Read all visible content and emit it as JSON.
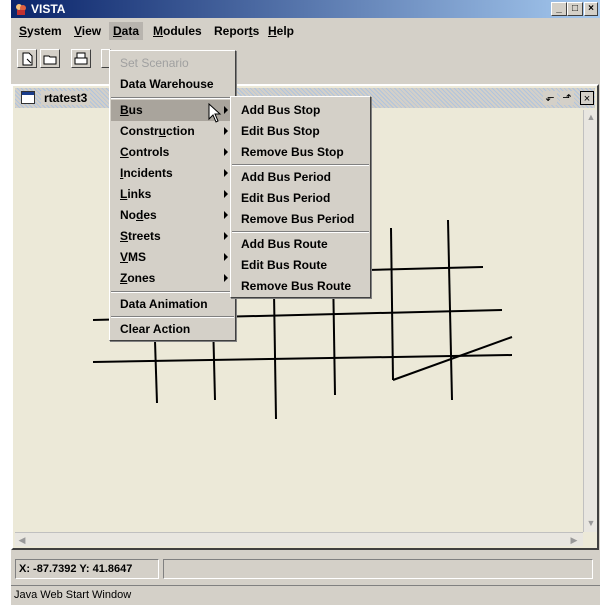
{
  "window": {
    "title": "VISTA"
  },
  "menubar": [
    {
      "label": "System",
      "ul": "S",
      "rest": "ystem"
    },
    {
      "label": "View",
      "ul": "V",
      "rest": "iew"
    },
    {
      "label": "Data",
      "ul": "D",
      "rest": "ata"
    },
    {
      "label": "Modules",
      "ul": "M",
      "rest": "odules"
    },
    {
      "label": "Reports",
      "pre": "Repor",
      "ul": "t",
      "rest": "s"
    },
    {
      "label": "Help",
      "ul": "H",
      "rest": "elp"
    }
  ],
  "internal_frame": {
    "title": "rtatest3"
  },
  "data_menu": {
    "items": [
      {
        "label": "Set Scenario",
        "disabled": true
      },
      {
        "label": "Data Warehouse"
      },
      {
        "label": "Bus",
        "ul": "B",
        "rest": "us",
        "submenu": true,
        "selected": true
      },
      {
        "label": "Construction",
        "pre": "Constr",
        "ul": "u",
        "rest": "ction",
        "submenu": true
      },
      {
        "label": "Controls",
        "ul": "C",
        "rest": "ontrols",
        "submenu": true
      },
      {
        "label": "Incidents",
        "ul": "I",
        "rest": "ncidents",
        "submenu": true
      },
      {
        "label": "Links",
        "ul": "L",
        "rest": "inks",
        "submenu": true
      },
      {
        "label": "Nodes",
        "pre": "No",
        "ul": "d",
        "rest": "es",
        "submenu": true
      },
      {
        "label": "Streets",
        "ul": "S",
        "rest": "treets",
        "submenu": true
      },
      {
        "label": "VMS",
        "ul": "V",
        "rest": "MS",
        "submenu": true
      },
      {
        "label": "Zones",
        "ul": "Z",
        "rest": "ones",
        "submenu": true
      },
      {
        "label": "Data Animation"
      },
      {
        "label": "Clear Action"
      }
    ]
  },
  "bus_submenu": {
    "groups": [
      [
        "Add Bus Stop",
        "Edit Bus Stop",
        "Remove Bus Stop"
      ],
      [
        "Add Bus Period",
        "Edit Bus Period",
        "Remove Bus Period"
      ],
      [
        "Add Bus Route",
        "Edit Bus Route",
        "Remove Bus Route"
      ]
    ]
  },
  "status": {
    "coordinates": "X: -87.7392 Y: 41.8647"
  },
  "footer": {
    "text": "Java Web Start Window"
  },
  "icons": [
    "app-icon",
    "new-file-icon",
    "open-file-icon",
    "print-icon",
    "minimize-icon",
    "maximize-icon",
    "close-icon",
    "frame-icon",
    "restore-frame-icon",
    "iconify-frame-icon",
    "close-frame-icon",
    "mouse-cursor-icon"
  ]
}
